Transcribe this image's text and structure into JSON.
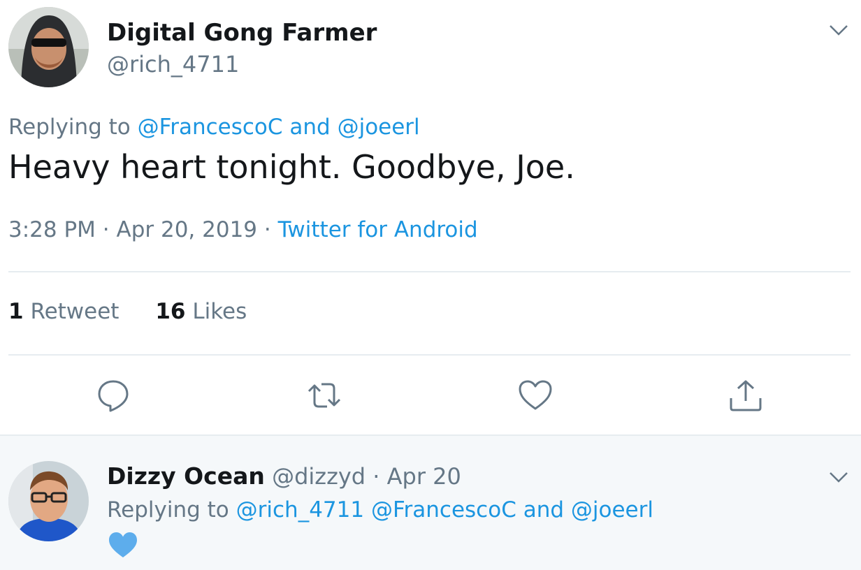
{
  "tweet": {
    "author_name": "Digital Gong Farmer",
    "author_handle": "@rich_4711",
    "replying_prefix": "Replying to",
    "replying_to_1": "@FrancescoC",
    "replying_and": "and",
    "replying_to_2": "@joeerl",
    "text": "Heavy heart tonight. Goodbye, Joe.",
    "time": "3:28 PM",
    "separator": "·",
    "date": "Apr 20, 2019",
    "source": "Twitter for Android",
    "retweet_count": "1",
    "retweet_label": "Retweet",
    "like_count": "16",
    "like_label": "Likes",
    "actions": [
      "reply-icon",
      "retweet-icon",
      "like-icon",
      "share-icon"
    ]
  },
  "reply": {
    "author_name": "Dizzy Ocean",
    "author_handle": "@dizzyd",
    "separator": "·",
    "date": "Apr 20",
    "replying_prefix": "Replying to",
    "replying_to_1": "@rich_4711",
    "replying_to_2": "@FrancescoC",
    "replying_and": "and",
    "replying_to_3": "@joeerl",
    "emoji": "blue-heart-icon"
  },
  "colors": {
    "link": "#1b95e0",
    "secondary": "#657786",
    "primary": "#14171a",
    "divider": "#e6ecf0",
    "reply_bg": "#f5f8fa",
    "blue_heart": "#5dadec"
  }
}
